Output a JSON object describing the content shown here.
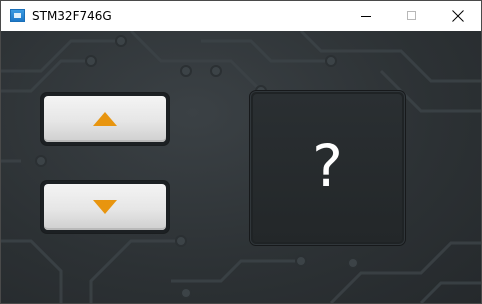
{
  "window": {
    "title": "STM32F746G",
    "controls": [
      "minimize",
      "maximize",
      "close"
    ]
  },
  "app": {
    "up_button": {
      "icon": "up-triangle-icon",
      "color": "#e8950f"
    },
    "down_button": {
      "icon": "down-triangle-icon",
      "color": "#e8950f"
    },
    "display": {
      "value": "?"
    }
  },
  "colors": {
    "background": "#2c3134",
    "accent": "#e8950f",
    "button_face": "#e6e6e6"
  }
}
